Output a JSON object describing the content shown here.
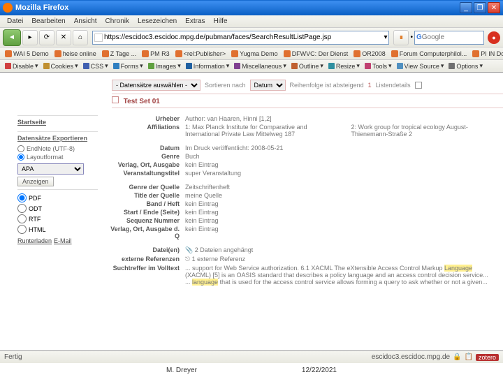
{
  "window": {
    "title": "Mozilla Firefox"
  },
  "menus": [
    "Datei",
    "Bearbeiten",
    "Ansicht",
    "Chronik",
    "Lesezeichen",
    "Extras",
    "Hilfe"
  ],
  "url": "https://escidoc3.escidoc.mpg.de/pubman/faces/SearchResultListPage.jsp",
  "search_ph": "Google",
  "bookmarks": [
    "WAI 5 Demo",
    "heise online",
    "Z Tage ...",
    "PM R3",
    "<rel:Publisher>",
    "Yugma Demo",
    "DFWVC: Der Dienst",
    "OR2008",
    "Forum Computerphilol...",
    "PI IN Docs"
  ],
  "devtools": [
    "Disable",
    "Cookies",
    "CSS",
    "Forms",
    "Images",
    "Information",
    "Miscellaneous",
    "Outline",
    "Resize",
    "Tools",
    "View Source",
    "Options"
  ],
  "devcolors": [
    "#d04040",
    "#c09030",
    "#4060b0",
    "#3080c0",
    "#60a040",
    "#2060a0",
    "#804090",
    "#c06030",
    "#3090a0",
    "#c04070",
    "#5090c0",
    "#707070"
  ],
  "filter": {
    "select1": "- Datensätze auswählen -",
    "sort_lbl": "Sortieren nach",
    "sort_val": "Datum",
    "order_lbl": "Reihenfolge ist absteigend",
    "num": "1",
    "details": "Listendetails"
  },
  "setname": "Test Set 01",
  "sidebar": {
    "start": "Startseite",
    "export_title": "Datensätze Exportieren",
    "opt_endnote": "EndNote (UTF-8)",
    "opt_layout": "Layoutformat",
    "sel": "APA",
    "btn": "Anzeigen",
    "fmt": [
      "PDF",
      "ODT",
      "RTF",
      "HTML"
    ],
    "download": "Runterladen",
    "email": "E-Mail"
  },
  "meta": {
    "urheber_lbl": "Urheber",
    "urheber": "Author: van Haaren, Hinni [1,2]",
    "affil_lbl": "Affiliations",
    "affil1": "1: Max Planck Institute for Comparative and International Private Law Mittelweg 187",
    "affil2": "2: Work group for tropical ecology August-Thienemann-Straße 2",
    "datum_lbl": "Datum",
    "datum": "Im Druck veröffentlicht: 2008-05-21",
    "genre_lbl": "Genre",
    "genre": "Buch",
    "verlag_lbl": "Verlag, Ort, Ausgabe",
    "verlag": "kein Eintrag",
    "veranst_lbl": "Veranstaltungstitel",
    "veranst": "super Veranstaltung",
    "genreq_lbl": "Genre der Quelle",
    "genreq": "Zeitschriftenheft",
    "titleq_lbl": "Title der Quelle",
    "titleq": "meine Quelle",
    "band_lbl": "Band / Heft",
    "band": "kein Eintrag",
    "seite_lbl": "Start / Ende (Seite)",
    "seite": "kein Eintrag",
    "seq_lbl": "Sequenz Nummer",
    "seq": "kein Eintrag",
    "verlagq_lbl": "Verlag, Ort, Ausgabe d. Q",
    "verlagq": "kein Eintrag",
    "datei_lbl": "Datei(en)",
    "datei": "2 Dateien angehängt",
    "extref_lbl": "externe Referenzen",
    "extref": "1 externe Referenz",
    "volltext_lbl": "Suchtreffer im Volltext",
    "vt1a": "... support for Web Service authorization. 6.1 XACML The eXtensible Access Control Markup ",
    "vt1b": "Language",
    "vt1c": " (XACML) [5] is an OASIS standard that describes a policy language and an access control decision service...",
    "vt2a": "... ",
    "vt2b": "language",
    "vt2c": " that is used for the access control service allows forming a query to ask whether or not a given..."
  },
  "status": {
    "left": "Fertig",
    "host": "escidoc3.escidoc.mpg.de",
    "zotero": "zotero"
  },
  "footer": {
    "author": "M. Dreyer",
    "date": "12/22/2021"
  }
}
